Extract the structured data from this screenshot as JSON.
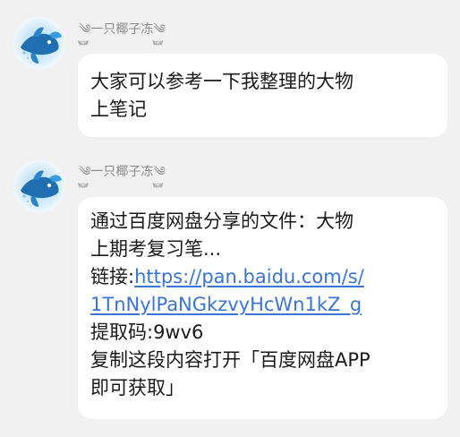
{
  "messages": [
    {
      "sender": "༄࿆一只椰子冻༄࿆",
      "text_line1": "大家可以参考一下我整理的大物",
      "text_line2": "上笔记"
    },
    {
      "sender": "༄࿆一只椰子冻༄࿆",
      "share_title": "通过百度网盘分享的文件：大物",
      "share_title2": "上期考复习笔...",
      "link_label": "链接:",
      "link_part1": "https://pan.baidu.com/s/",
      "link_part2": "1TnNylPaNGkzvyHcWn1kZ_g",
      "code_label": "提取码:9wv6",
      "instruction1": "复制这段内容打开「百度网盘APP",
      "instruction2": "即可获取」"
    }
  ],
  "colors": {
    "background": "#f1f1f1",
    "bubble": "#ffffff",
    "link": "#3a74d6",
    "sender": "#8a8a8a"
  },
  "icons": {
    "avatar": "blue-fish-avatar-icon"
  }
}
